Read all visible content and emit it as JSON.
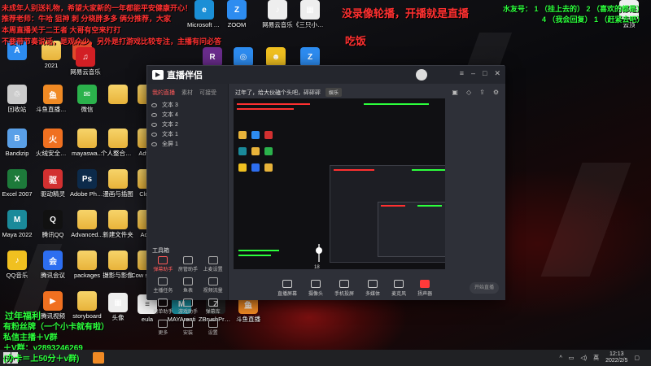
{
  "desktop": {
    "icons": [
      {
        "label": "",
        "color": "#2d8cf0",
        "glyph": "A"
      },
      {
        "label": "",
        "color": "#e04a2a",
        "glyph": "◉"
      },
      {
        "label": "ZOOM",
        "color": "#2d8cf0",
        "glyph": "Z"
      },
      {
        "label": "Microsoft Edge",
        "color": "#1b8fd6",
        "glyph": "e"
      },
      {
        "label": "网易云音乐",
        "color": "#eee",
        "glyph": "♪"
      },
      {
        "label": "《三只小猫》图片",
        "color": "#eee",
        "glyph": "▦"
      },
      {
        "label": "2021",
        "color": "#e8b33a",
        "glyph": ""
      },
      {
        "label": "网易云音乐",
        "color": "#d21f24",
        "glyph": "♫"
      },
      {
        "label": "RAR",
        "color": "#6a2c8c",
        "glyph": "R"
      },
      {
        "label": "",
        "color": "#2d8cf0",
        "glyph": "◎"
      },
      {
        "label": "",
        "color": "#f0c020",
        "glyph": "☻"
      },
      {
        "label": "ZIP",
        "color": "#2d8cf0",
        "glyph": "Z"
      },
      {
        "label": "回收站",
        "color": "#ccc",
        "glyph": "♲"
      },
      {
        "label": "斗鱼直播伴侣",
        "color": "#f08a24",
        "glyph": "鱼"
      },
      {
        "label": "微信",
        "color": "#2bb24c",
        "glyph": "✉"
      },
      {
        "label": "",
        "color": "#e8b33a",
        "glyph": ""
      },
      {
        "label": "",
        "color": "#e8b33a",
        "glyph": ""
      },
      {
        "label": "Bandizip",
        "color": "#5aa0e8",
        "glyph": "B"
      },
      {
        "label": "火绒安全软件",
        "color": "#f07020",
        "glyph": "火"
      },
      {
        "label": "mayaswa...",
        "color": "#e8b33a",
        "glyph": ""
      },
      {
        "label": "个人整合设计",
        "color": "#e8b33a",
        "glyph": ""
      },
      {
        "label": "Advan",
        "color": "#e8b33a",
        "glyph": ""
      },
      {
        "label": "Excel 2007",
        "color": "#1d7a3a",
        "glyph": "X"
      },
      {
        "label": "驱动精灵",
        "color": "#d23030",
        "glyph": "驱"
      },
      {
        "label": "Adobe Photosh...",
        "color": "#0c2a4a",
        "glyph": "Ps"
      },
      {
        "label": "漫画与插图",
        "color": "#e8b33a",
        "glyph": ""
      },
      {
        "label": "Cloud",
        "color": "#e8b33a",
        "glyph": ""
      },
      {
        "label": "Maya 2022",
        "color": "#1a8a9a",
        "glyph": "M"
      },
      {
        "label": "腾讯QQ",
        "color": "#111",
        "glyph": "Q"
      },
      {
        "label": "Advanced...",
        "color": "#e8b33a",
        "glyph": ""
      },
      {
        "label": "新建文件夹",
        "color": "#e8b33a",
        "glyph": ""
      },
      {
        "label": "Adve",
        "color": "#e8b33a",
        "glyph": ""
      },
      {
        "label": "QQ音乐",
        "color": "#f0c020",
        "glyph": "♪"
      },
      {
        "label": "腾讯会议",
        "color": "#2d6ef0",
        "glyph": "会"
      },
      {
        "label": "packages",
        "color": "#e8b33a",
        "glyph": ""
      },
      {
        "label": "摄影与影像",
        "color": "#e8b33a",
        "glyph": ""
      },
      {
        "label": "Cow studen",
        "color": "#e8b33a",
        "glyph": ""
      },
      {
        "label": "腾讯视频",
        "color": "#f07020",
        "glyph": "▶"
      },
      {
        "label": "storyboard",
        "color": "#e8b33a",
        "glyph": ""
      },
      {
        "label": "头像",
        "color": "#eee",
        "glyph": "▦"
      },
      {
        "label": "eula",
        "color": "#f2f2f2",
        "glyph": "≡"
      },
      {
        "label": "MAYArenti",
        "color": "#1a8a9a",
        "glyph": "M"
      },
      {
        "label": "ZBrushPro renti",
        "color": "#222",
        "glyph": "Z"
      },
      {
        "label": "斗鱼直播",
        "color": "#f08a24",
        "glyph": "鱼"
      },
      {
        "label": "云顶",
        "color": "#eee",
        "glyph": "▦"
      }
    ]
  },
  "overlay": {
    "top_left_lines": [
      "未成年人别送礼物，希望大家新的一年都能平安健康开心！",
      "推荐老师：牛哈 狙神 刺 分晓胖多多 俩分推荐，大家",
      "本周直播关于二王者 大哥有空来打打",
      "不要带节奏说话，是观众少，另外是打游戏比较专注，主播有问必答"
    ],
    "top_center": "没录像轮播，开播就是直播",
    "sub_center": "吃饭",
    "top_right_line1": "水友号： 1 （挂上去的） 2 （喜欢的都是）",
    "top_right_line2": "4 （我会回复） 1 （赶紧去吧）",
    "bottom_left": [
      "过年福利",
      "有粉丝牌（一个小卡就有啦）",
      "私信主播＋V群",
      "＋V群：y2893246269",
      "(办卡＝上50分＋v群)"
    ]
  },
  "app": {
    "name": "直播伴侣",
    "tabs": [
      "我的直播",
      "素材",
      "可接受"
    ],
    "scenes": [
      "文本 3",
      "文本 4",
      "文本 2",
      "文本 1",
      "全屏 1"
    ],
    "toolbox_title": "工具箱",
    "tools": [
      {
        "label": "弹幕助手",
        "hot": true
      },
      {
        "label": "房管助手",
        "hot": false
      },
      {
        "label": "上麦设置",
        "hot": false
      },
      {
        "label": "主播任务",
        "hot": false
      },
      {
        "label": "鱼表",
        "hot": false
      },
      {
        "label": "视频流量",
        "hot": false
      },
      {
        "label": "榜单助手",
        "hot": false
      },
      {
        "label": "游戏助手",
        "hot": false
      },
      {
        "label": "弹幕库",
        "hot": false
      },
      {
        "label": "更多",
        "hot": false
      },
      {
        "label": "安装",
        "hot": false
      },
      {
        "label": "设置",
        "hot": false
      }
    ],
    "stage_title": "过年了，给大伙磕个头吧，砰砰砰",
    "stage_tag": "娱乐",
    "bottom_buttons": [
      {
        "label": "直播屏幕",
        "live": false
      },
      {
        "label": "摄像头",
        "live": false
      },
      {
        "label": "手机投屏",
        "live": false
      },
      {
        "label": "多媒体",
        "live": false
      },
      {
        "label": "麦克风",
        "live": false
      },
      {
        "label": "扬声器",
        "live": true
      }
    ],
    "start_button": "开始直播",
    "volume_value": "18"
  },
  "taskbar": {
    "time": "12:13",
    "date": "2022/2/5",
    "lang": "英"
  }
}
